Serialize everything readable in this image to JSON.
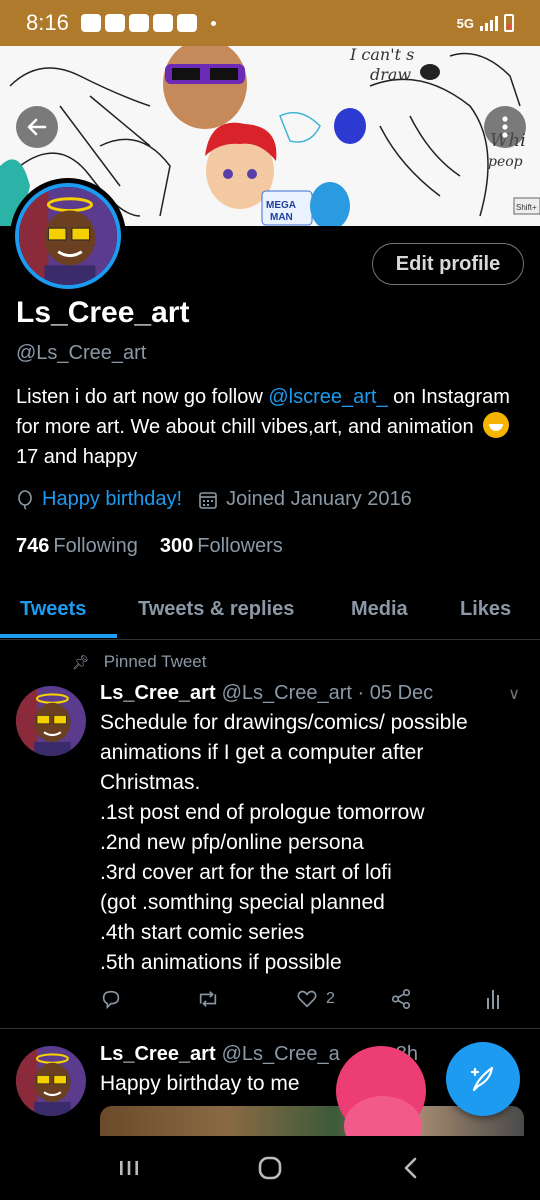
{
  "status_bar": {
    "time": "8:16",
    "network": "5G",
    "colors": {
      "background": "#b07a2c"
    }
  },
  "profile": {
    "display_name": "Ls_Cree_art",
    "handle": "@Ls_Cree_art",
    "edit_button": "Edit profile",
    "bio_part1": "Listen i do art now go follow ",
    "bio_mention": "@lscree_art_",
    "bio_part2": " on Instagram for more art. We about chill vibes,art, and animation ",
    "bio_part3": " 17 and happy",
    "birthday": "Happy birthday!",
    "joined": "Joined January 2016",
    "following_count": "746",
    "following_label": "Following",
    "followers_count": "300",
    "followers_label": "Followers",
    "banner_texts": [
      "I can't s",
      "draw",
      "MEGA MAN",
      "Whi",
      "peop",
      "Shift+"
    ]
  },
  "tabs": [
    {
      "label": "Tweets",
      "active": true
    },
    {
      "label": "Tweets & replies",
      "active": false
    },
    {
      "label": "Media",
      "active": false
    },
    {
      "label": "Likes",
      "active": false
    }
  ],
  "tweets": [
    {
      "pinned_label": "Pinned Tweet",
      "name": "Ls_Cree_art",
      "meta": "@Ls_Cree_art · 05 Dec",
      "text": "Schedule for drawings/comics/ possible animations if I get a computer after Christmas.\n.1st post end of prologue tomorrow\n.2nd new pfp/online persona\n.3rd cover art for the start of lofi\n(got .somthing special planned\n.4th start comic series\n.5th animations if possible",
      "likes": "2"
    },
    {
      "name": "Ls_Cree_art",
      "meta": "@Ls_Cree_a",
      "time": "8h",
      "text": "Happy  birthday to me"
    }
  ],
  "icons": {
    "back": "arrow-left-icon",
    "more": "more-vertical-icon",
    "balloon": "balloon-icon",
    "calendar": "calendar-icon",
    "pin": "pin-icon",
    "reply": "reply-icon",
    "retweet": "retweet-icon",
    "like": "heart-icon",
    "share": "share-icon",
    "analytics": "analytics-icon",
    "compose": "compose-icon"
  },
  "colors": {
    "accent": "#1d9bf0",
    "secondary_text": "#8b98a5",
    "background": "#000000"
  }
}
